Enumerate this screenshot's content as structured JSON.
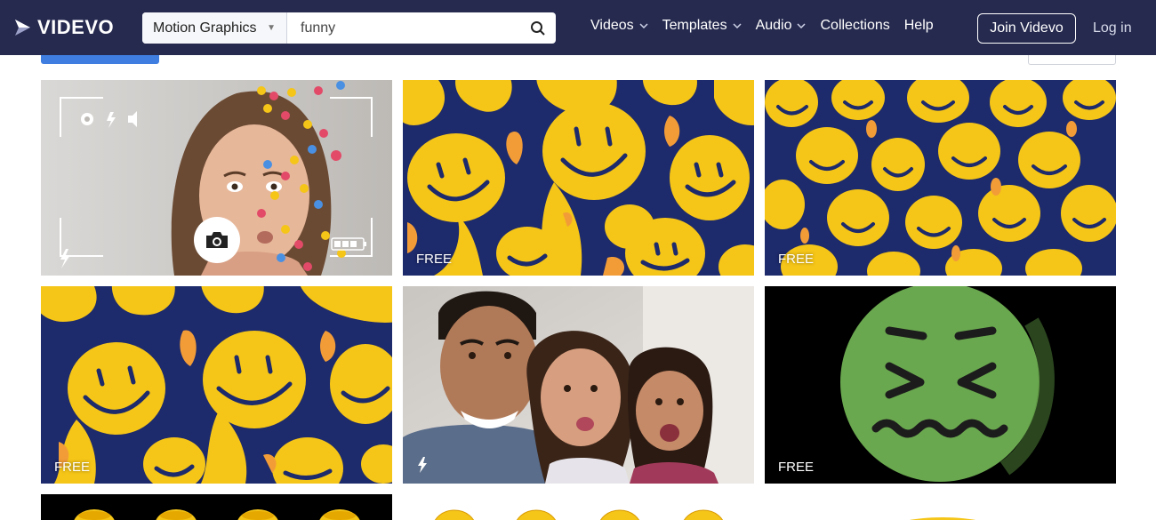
{
  "brand": {
    "name": "VIDEVO"
  },
  "search": {
    "category": "Motion Graphics",
    "query": "funny"
  },
  "nav": [
    {
      "label": "Videos",
      "has_dropdown": true
    },
    {
      "label": "Templates",
      "has_dropdown": true
    },
    {
      "label": "Audio",
      "has_dropdown": true
    },
    {
      "label": "Collections",
      "has_dropdown": false
    },
    {
      "label": "Help",
      "has_dropdown": false
    }
  ],
  "join_label": "Join Videvo",
  "login_label": "Log in",
  "tiles": [
    {
      "kind": "selfie-emoji-reactions",
      "badge": ""
    },
    {
      "kind": "melting-smileys",
      "badge": "FREE"
    },
    {
      "kind": "melting-smileys",
      "badge": "FREE"
    },
    {
      "kind": "melting-smileys",
      "badge": "FREE"
    },
    {
      "kind": "family-selfie",
      "badge": ""
    },
    {
      "kind": "green-emoji-face",
      "badge": "FREE"
    }
  ],
  "colors": {
    "header_bg": "#262a4f",
    "smiley_yellow": "#f5c518",
    "smiley_navy": "#1d2a6b",
    "green_face": "#6aa84f"
  }
}
